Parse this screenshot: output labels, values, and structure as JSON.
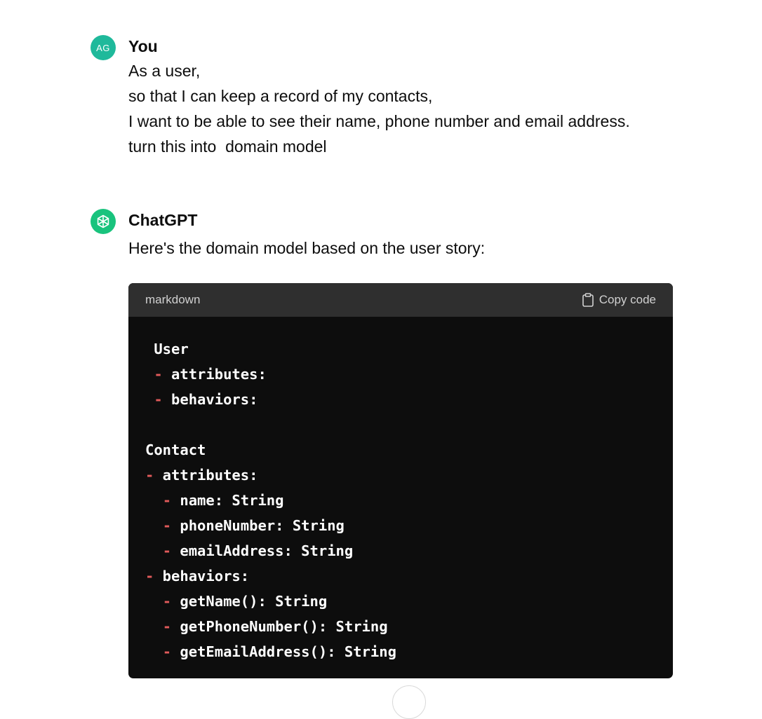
{
  "user_message": {
    "avatar_initials": "AG",
    "author": "You",
    "lines": [
      "As a user,",
      "so that I can keep a record of my contacts,",
      "I want to be able to see their name, phone number and email address.",
      "turn this into  domain model"
    ]
  },
  "assistant_message": {
    "author": "ChatGPT",
    "intro": "Here's the domain model based on the user story:",
    "code_block": {
      "language": "markdown",
      "copy_label": "Copy code",
      "lines": [
        {
          "indent": " ",
          "dash": "",
          "text": "User"
        },
        {
          "indent": " ",
          "dash": "-",
          "text": " attributes:"
        },
        {
          "indent": " ",
          "dash": "-",
          "text": " behaviors:"
        },
        {
          "indent": "",
          "dash": "",
          "text": ""
        },
        {
          "indent": "",
          "dash": "",
          "text": "Contact"
        },
        {
          "indent": "",
          "dash": "-",
          "text": " attributes:"
        },
        {
          "indent": "  ",
          "dash": "-",
          "text": " name: String"
        },
        {
          "indent": "  ",
          "dash": "-",
          "text": " phoneNumber: String"
        },
        {
          "indent": "  ",
          "dash": "-",
          "text": " emailAddress: String"
        },
        {
          "indent": "",
          "dash": "-",
          "text": " behaviors:"
        },
        {
          "indent": "  ",
          "dash": "-",
          "text": " getName(): String"
        },
        {
          "indent": "  ",
          "dash": "-",
          "text": " getPhoneNumber(): String"
        },
        {
          "indent": "  ",
          "dash": "-",
          "text": " getEmailAddress(): String"
        }
      ]
    }
  },
  "icons": {
    "gpt_logo": "openai-logo-icon",
    "copy": "clipboard-icon",
    "scroll": "scroll-down-button"
  },
  "colors": {
    "user_avatar": "#1fb99b",
    "gpt_avatar": "#19c37d",
    "code_bg": "#0d0d0d",
    "code_header_bg": "#2f2f2f",
    "code_dash": "#e05a5a"
  }
}
